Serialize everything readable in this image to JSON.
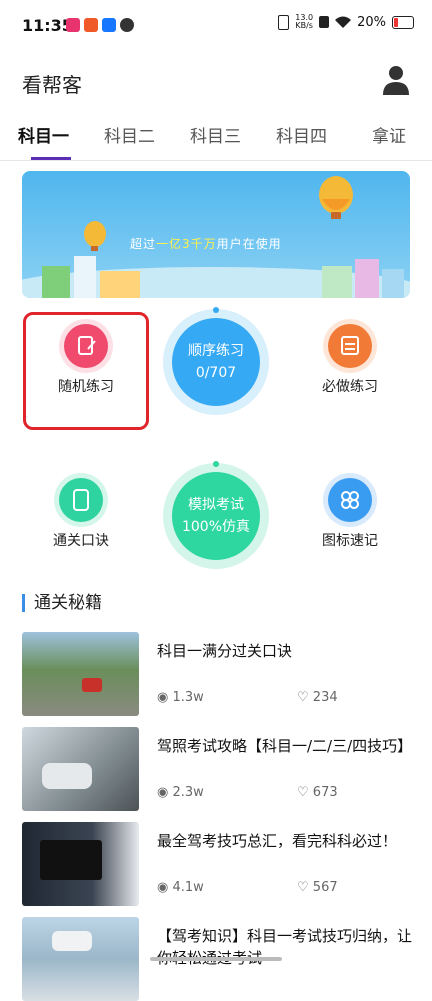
{
  "status": {
    "time": "11:35",
    "netspeed_value": "13.0",
    "netspeed_unit": "KB/s",
    "battery": "20%"
  },
  "header": {
    "title": "看帮客",
    "avatar_icon": "user-icon"
  },
  "tabs": [
    {
      "label": "科目一",
      "active": true
    },
    {
      "label": "科目二"
    },
    {
      "label": "科目三"
    },
    {
      "label": "科目四"
    },
    {
      "label": "拿证"
    }
  ],
  "banner": {
    "text_pre": "超过",
    "text_hl": "一亿3千万",
    "text_post": "用户在使用"
  },
  "grid": {
    "random": {
      "label": "随机练习",
      "icon": "edit-icon",
      "color": "#f04a6c"
    },
    "sequence": {
      "title": "顺序练习",
      "progress": "0/707",
      "color": "#35a9f4"
    },
    "must": {
      "label": "必做练习",
      "icon": "checklist-icon",
      "color": "#f27a37"
    },
    "tips": {
      "label": "通关口诀",
      "icon": "scroll-icon",
      "color": "#2fd39f"
    },
    "exam": {
      "title": "模拟考试",
      "sub": "100%仿真",
      "color": "#2ed6a0"
    },
    "signs": {
      "label": "图标速记",
      "icon": "grid-icon",
      "color": "#3a9cf0"
    }
  },
  "section": {
    "title": "通关秘籍"
  },
  "articles": [
    {
      "title": "科目一满分过关口诀",
      "views": "1.3w",
      "likes": "234"
    },
    {
      "title": "驾照考试攻略【科目一/二/三/四技巧】",
      "views": "2.3w",
      "likes": "673"
    },
    {
      "title": "最全驾考技巧总汇，看完科科必过！",
      "views": "4.1w",
      "likes": "567"
    },
    {
      "title": "【驾考知识】科目一考试技巧归纳，让你轻松通过考试",
      "views": "",
      "likes": ""
    }
  ]
}
